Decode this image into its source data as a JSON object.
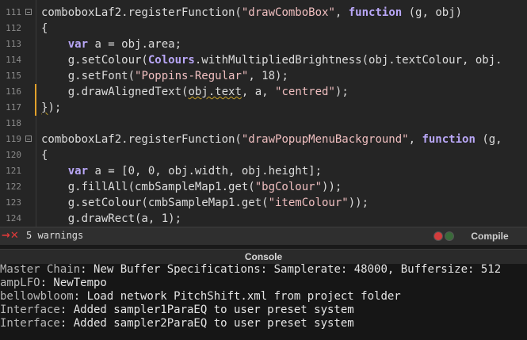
{
  "editor": {
    "lines": [
      {
        "num": "111",
        "parts": [
          [
            "t",
            "comboboxLaf2.registerFunction("
          ],
          [
            "s",
            "\"drawComboBox\""
          ],
          [
            "t",
            ", "
          ],
          [
            "k",
            "function"
          ],
          [
            "t",
            " (g, obj)"
          ]
        ]
      },
      {
        "num": "112",
        "parts": [
          [
            "t",
            "{"
          ]
        ]
      },
      {
        "num": "113",
        "parts": [
          [
            "t",
            "    "
          ],
          [
            "k",
            "var"
          ],
          [
            "t",
            " a = obj.area;"
          ]
        ]
      },
      {
        "num": "114",
        "parts": [
          [
            "t",
            "    g.setColour("
          ],
          [
            "c",
            "Colours"
          ],
          [
            "t",
            ".withMultipliedBrightness(obj.textColour, obj."
          ]
        ]
      },
      {
        "num": "115",
        "parts": [
          [
            "t",
            "    g.setFont("
          ],
          [
            "s",
            "\"Poppins-Regular\""
          ],
          [
            "t",
            ", 18);"
          ]
        ]
      },
      {
        "num": "116",
        "parts": [
          [
            "t",
            "    g.drawAlignedText("
          ],
          [
            "w",
            "obj.text"
          ],
          [
            "t",
            ", a, "
          ],
          [
            "s",
            "\"centred\""
          ],
          [
            "t",
            ");"
          ]
        ]
      },
      {
        "num": "117",
        "parts": [
          [
            "w",
            "}"
          ],
          [
            "t",
            ");"
          ]
        ]
      },
      {
        "num": "118",
        "parts": [
          [
            "t",
            ""
          ]
        ]
      },
      {
        "num": "119",
        "parts": [
          [
            "t",
            "comboboxLaf2.registerFunction("
          ],
          [
            "s",
            "\"drawPopupMenuBackground\""
          ],
          [
            "t",
            ", "
          ],
          [
            "k",
            "function"
          ],
          [
            "t",
            " (g,"
          ]
        ]
      },
      {
        "num": "120",
        "parts": [
          [
            "t",
            "{"
          ]
        ]
      },
      {
        "num": "121",
        "parts": [
          [
            "t",
            "    "
          ],
          [
            "k",
            "var"
          ],
          [
            "t",
            " a = [0, 0, obj.width, obj.height];"
          ]
        ]
      },
      {
        "num": "122",
        "parts": [
          [
            "t",
            "    g.fillAll(cmbSampleMap1.get("
          ],
          [
            "s",
            "\"bgColour\""
          ],
          [
            "t",
            "));"
          ]
        ]
      },
      {
        "num": "123",
        "parts": [
          [
            "t",
            "    g.setColour(cmbSampleMap1.get("
          ],
          [
            "s",
            "\"itemColour\""
          ],
          [
            "t",
            "));"
          ]
        ]
      },
      {
        "num": "124",
        "parts": [
          [
            "t",
            "    g.drawRect(a, 1);"
          ]
        ]
      }
    ]
  },
  "status": {
    "warning_icon": "error-cross-icon",
    "warnings": "5 warnings",
    "compile_label": "Compile"
  },
  "console": {
    "title": "Console",
    "lines": [
      {
        "source": "Master Chain",
        "message": ": New Buffer Specifications: Samplerate: 48000, Buffersize: 512"
      },
      {
        "source": "ampLFO",
        "message": ": NewTempo"
      },
      {
        "source": "bellowbloom",
        "message": ": Load network PitchShift.xml from project folder"
      },
      {
        "source": "Interface",
        "message": ": Added sampler1ParaEQ to user preset system"
      },
      {
        "source": "Interface",
        "message": ": Added sampler2ParaEQ to user preset system"
      }
    ]
  },
  "colors": {
    "keyword": "#b9a7f7",
    "string": "#f0bfc0",
    "modified_bar": "#e2a12b",
    "error": "#e03a3a"
  }
}
